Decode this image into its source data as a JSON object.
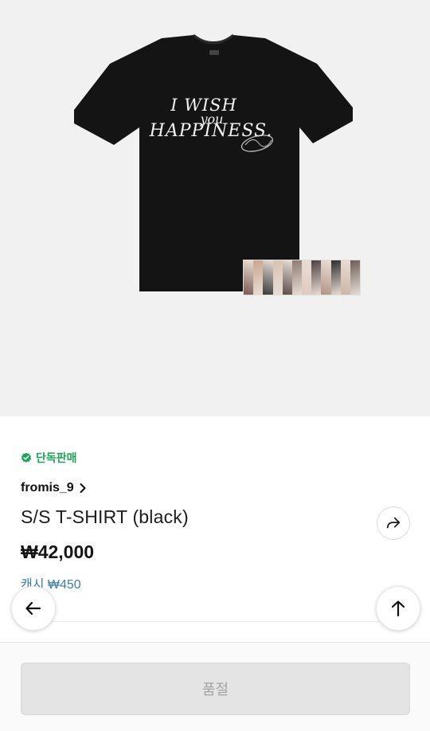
{
  "product": {
    "image": {
      "print_lines": [
        "I WISH",
        "you",
        "HAPPINESS."
      ],
      "photo_colors": [
        "#7a5a55",
        "#c9a48f",
        "#3a3a3a",
        "#d8c1b0",
        "#5a4b48",
        "#8e7a72",
        "#e0c9c0",
        "#4d3f3e",
        "#b39486",
        "#2f2b2c",
        "#cdb4a6",
        "#6d5d5a"
      ]
    },
    "exclusive_badge": "단독판매",
    "artist": "fromis_9",
    "title": "S/S T-SHIRT (black)",
    "price": "₩42,000",
    "cash": "캐시 ₩450"
  },
  "actions": {
    "share_icon": "share-arrow-icon",
    "back_icon": "arrow-left-icon",
    "top_icon": "arrow-up-icon",
    "soldout_label": "품절"
  },
  "colors": {
    "badge_green": "#1fa35a",
    "cash_blue": "#3b7ea8",
    "shirt_black": "#141414"
  }
}
